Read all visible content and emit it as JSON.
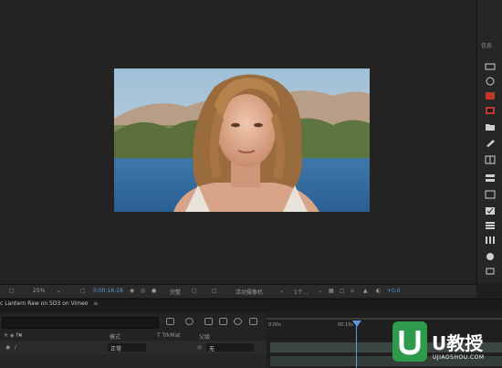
{
  "right_panel": {
    "header": "信息"
  },
  "viewer_toolbar": {
    "zoom": "25%",
    "timecode": "0:00:16:18",
    "resolution": "完整",
    "camera": "活动摄像机",
    "views": "1个...",
    "exposure": "+0.0"
  },
  "timeline": {
    "tab_label": "c Lantern Raw on 5D3 on Vimeo",
    "col_mode": "模式",
    "col_trkmat": "T TrkMat",
    "col_parent": "父级",
    "layer_mode": "正常",
    "layer_parent": "无",
    "ruler_start": "0:00s",
    "ruler_mark": "00:15s"
  },
  "watermark": {
    "brand": "U教授",
    "url": "UJIAOSHOU.COM"
  }
}
